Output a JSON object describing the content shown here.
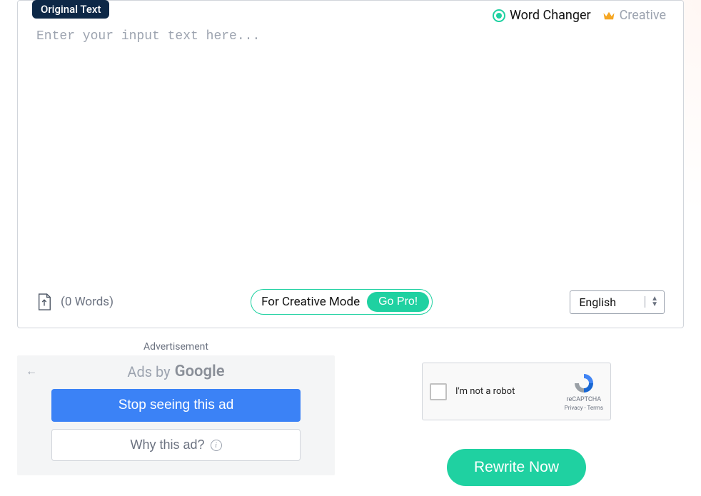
{
  "editor": {
    "badge": "Original Text",
    "placeholder": "Enter your input text here...",
    "value": ""
  },
  "modes": {
    "word_changer": "Word Changer",
    "creative": "Creative"
  },
  "footer": {
    "word_count": "(0 Words)",
    "creative_mode_text": "For Creative Mode",
    "go_pro": "Go Pro!",
    "language": "English"
  },
  "ads": {
    "label": "Advertisement",
    "by_text": "Ads by",
    "google": "Google",
    "stop_btn": "Stop seeing this ad",
    "why_btn": "Why this ad?"
  },
  "recaptcha": {
    "text": "I'm not a robot",
    "brand": "reCAPTCHA",
    "privacy": "Privacy",
    "terms": "Terms",
    "sep": " - "
  },
  "action": {
    "rewrite": "Rewrite Now"
  }
}
